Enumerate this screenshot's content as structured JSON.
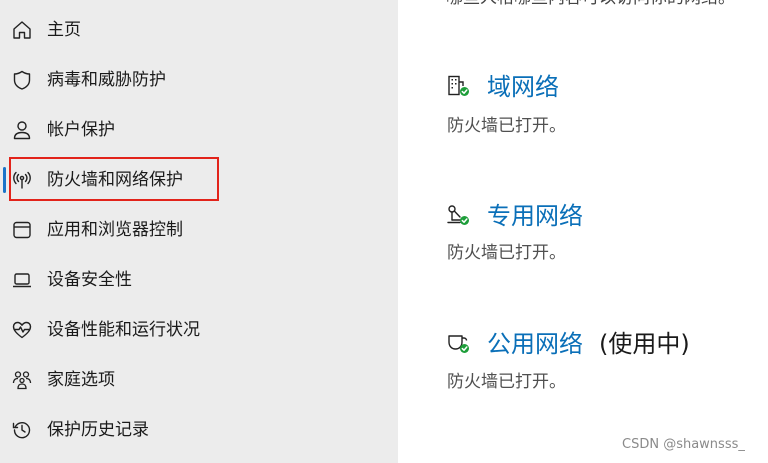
{
  "sidebar": {
    "items": [
      {
        "label": "主页",
        "icon": "home-icon"
      },
      {
        "label": "病毒和威胁防护",
        "icon": "shield-icon"
      },
      {
        "label": "帐户保护",
        "icon": "person-icon"
      },
      {
        "label": "防火墙和网络保护",
        "icon": "wireless-antenna-icon",
        "active": true
      },
      {
        "label": "应用和浏览器控制",
        "icon": "app-window-icon"
      },
      {
        "label": "设备安全性",
        "icon": "laptop-icon"
      },
      {
        "label": "设备性能和运行状况",
        "icon": "heart-pulse-icon"
      },
      {
        "label": "家庭选项",
        "icon": "family-icon"
      },
      {
        "label": "保护历史记录",
        "icon": "history-icon"
      }
    ]
  },
  "main": {
    "top_cut_text": "哪些人格哪些内容可以访问你的网络。",
    "networks": [
      {
        "title": "域网络",
        "suffix": "",
        "status": "防火墙已打开。",
        "icon": "domain-network-icon"
      },
      {
        "title": "专用网络",
        "suffix": "",
        "status": "防火墙已打开。",
        "icon": "private-network-icon"
      },
      {
        "title": "公用网络",
        "suffix": "(使用中)",
        "status": "防火墙已打开。",
        "icon": "public-network-icon"
      }
    ]
  },
  "watermark": "CSDN @shawnsss_",
  "colors": {
    "accent": "#0a6fb8",
    "highlight": "#e2231a",
    "status_ok": "#1e9e3a",
    "sidebar_bg": "#ececec"
  }
}
